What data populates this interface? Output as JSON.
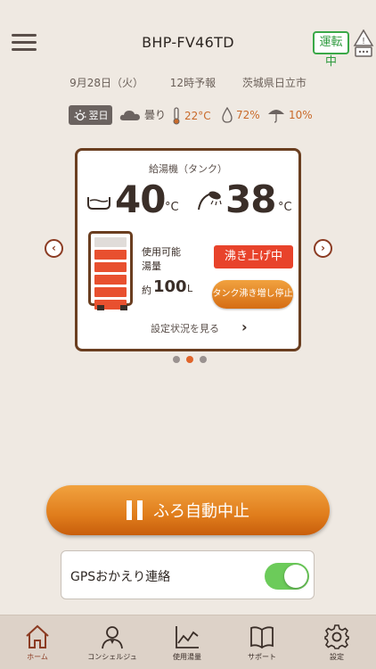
{
  "header": {
    "title": "BHP-FV46TD",
    "status_badge": "運転中"
  },
  "forecast": {
    "date": "9月28日（火）",
    "time": "12時予報",
    "location": "茨城県日立市"
  },
  "weather": {
    "day_tag": "翌日",
    "condition": "曇り",
    "temperature": "22°C",
    "humidity": "72%",
    "precipitation": "10%"
  },
  "card": {
    "title": "給湯機（タンク）",
    "bath_temp": "40",
    "shower_temp": "38",
    "unit": "°C",
    "available_label_1": "使用可能",
    "available_label_2": "湯量",
    "approx": "約",
    "amount": "100",
    "amount_unit": "L",
    "tank_level_segments_filled": 5,
    "tank_level_segments_total": 6,
    "boil_button": "沸き上げ中",
    "stop_button": "タンク沸き増し停止",
    "settings_link": "設定状況を見る"
  },
  "carousel": {
    "pages": 3,
    "active_index": 1
  },
  "main_button": {
    "label": "ふろ自動中止"
  },
  "gps": {
    "label": "GPSおかえり連絡",
    "enabled": true
  },
  "tabs": [
    {
      "label": "ホーム",
      "icon": "home-icon"
    },
    {
      "label": "コンシェルジュ",
      "icon": "concierge-icon"
    },
    {
      "label": "使用湯量",
      "icon": "chart-icon"
    },
    {
      "label": "サポート",
      "icon": "book-icon"
    },
    {
      "label": "設定",
      "icon": "gear-icon"
    }
  ],
  "colors": {
    "accent": "#e07d1c",
    "brand_brown": "#6a3e20",
    "boil_red": "#e8432b",
    "toggle_green": "#6ccb5a"
  }
}
